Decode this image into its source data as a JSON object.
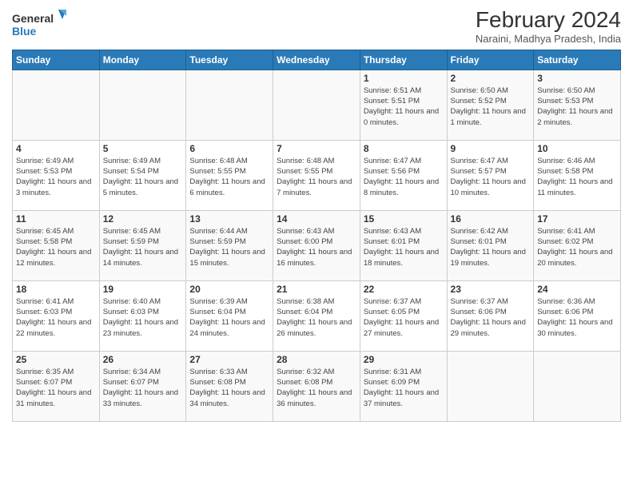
{
  "logo": {
    "line1": "General",
    "line2": "Blue"
  },
  "header": {
    "title": "February 2024",
    "subtitle": "Naraini, Madhya Pradesh, India"
  },
  "days_of_week": [
    "Sunday",
    "Monday",
    "Tuesday",
    "Wednesday",
    "Thursday",
    "Friday",
    "Saturday"
  ],
  "weeks": [
    [
      {
        "day": "",
        "info": ""
      },
      {
        "day": "",
        "info": ""
      },
      {
        "day": "",
        "info": ""
      },
      {
        "day": "",
        "info": ""
      },
      {
        "day": "1",
        "info": "Sunrise: 6:51 AM\nSunset: 5:51 PM\nDaylight: 11 hours and 0 minutes."
      },
      {
        "day": "2",
        "info": "Sunrise: 6:50 AM\nSunset: 5:52 PM\nDaylight: 11 hours and 1 minute."
      },
      {
        "day": "3",
        "info": "Sunrise: 6:50 AM\nSunset: 5:53 PM\nDaylight: 11 hours and 2 minutes."
      }
    ],
    [
      {
        "day": "4",
        "info": "Sunrise: 6:49 AM\nSunset: 5:53 PM\nDaylight: 11 hours and 3 minutes."
      },
      {
        "day": "5",
        "info": "Sunrise: 6:49 AM\nSunset: 5:54 PM\nDaylight: 11 hours and 5 minutes."
      },
      {
        "day": "6",
        "info": "Sunrise: 6:48 AM\nSunset: 5:55 PM\nDaylight: 11 hours and 6 minutes."
      },
      {
        "day": "7",
        "info": "Sunrise: 6:48 AM\nSunset: 5:55 PM\nDaylight: 11 hours and 7 minutes."
      },
      {
        "day": "8",
        "info": "Sunrise: 6:47 AM\nSunset: 5:56 PM\nDaylight: 11 hours and 8 minutes."
      },
      {
        "day": "9",
        "info": "Sunrise: 6:47 AM\nSunset: 5:57 PM\nDaylight: 11 hours and 10 minutes."
      },
      {
        "day": "10",
        "info": "Sunrise: 6:46 AM\nSunset: 5:58 PM\nDaylight: 11 hours and 11 minutes."
      }
    ],
    [
      {
        "day": "11",
        "info": "Sunrise: 6:45 AM\nSunset: 5:58 PM\nDaylight: 11 hours and 12 minutes."
      },
      {
        "day": "12",
        "info": "Sunrise: 6:45 AM\nSunset: 5:59 PM\nDaylight: 11 hours and 14 minutes."
      },
      {
        "day": "13",
        "info": "Sunrise: 6:44 AM\nSunset: 5:59 PM\nDaylight: 11 hours and 15 minutes."
      },
      {
        "day": "14",
        "info": "Sunrise: 6:43 AM\nSunset: 6:00 PM\nDaylight: 11 hours and 16 minutes."
      },
      {
        "day": "15",
        "info": "Sunrise: 6:43 AM\nSunset: 6:01 PM\nDaylight: 11 hours and 18 minutes."
      },
      {
        "day": "16",
        "info": "Sunrise: 6:42 AM\nSunset: 6:01 PM\nDaylight: 11 hours and 19 minutes."
      },
      {
        "day": "17",
        "info": "Sunrise: 6:41 AM\nSunset: 6:02 PM\nDaylight: 11 hours and 20 minutes."
      }
    ],
    [
      {
        "day": "18",
        "info": "Sunrise: 6:41 AM\nSunset: 6:03 PM\nDaylight: 11 hours and 22 minutes."
      },
      {
        "day": "19",
        "info": "Sunrise: 6:40 AM\nSunset: 6:03 PM\nDaylight: 11 hours and 23 minutes."
      },
      {
        "day": "20",
        "info": "Sunrise: 6:39 AM\nSunset: 6:04 PM\nDaylight: 11 hours and 24 minutes."
      },
      {
        "day": "21",
        "info": "Sunrise: 6:38 AM\nSunset: 6:04 PM\nDaylight: 11 hours and 26 minutes."
      },
      {
        "day": "22",
        "info": "Sunrise: 6:37 AM\nSunset: 6:05 PM\nDaylight: 11 hours and 27 minutes."
      },
      {
        "day": "23",
        "info": "Sunrise: 6:37 AM\nSunset: 6:06 PM\nDaylight: 11 hours and 29 minutes."
      },
      {
        "day": "24",
        "info": "Sunrise: 6:36 AM\nSunset: 6:06 PM\nDaylight: 11 hours and 30 minutes."
      }
    ],
    [
      {
        "day": "25",
        "info": "Sunrise: 6:35 AM\nSunset: 6:07 PM\nDaylight: 11 hours and 31 minutes."
      },
      {
        "day": "26",
        "info": "Sunrise: 6:34 AM\nSunset: 6:07 PM\nDaylight: 11 hours and 33 minutes."
      },
      {
        "day": "27",
        "info": "Sunrise: 6:33 AM\nSunset: 6:08 PM\nDaylight: 11 hours and 34 minutes."
      },
      {
        "day": "28",
        "info": "Sunrise: 6:32 AM\nSunset: 6:08 PM\nDaylight: 11 hours and 36 minutes."
      },
      {
        "day": "29",
        "info": "Sunrise: 6:31 AM\nSunset: 6:09 PM\nDaylight: 11 hours and 37 minutes."
      },
      {
        "day": "",
        "info": ""
      },
      {
        "day": "",
        "info": ""
      }
    ]
  ]
}
